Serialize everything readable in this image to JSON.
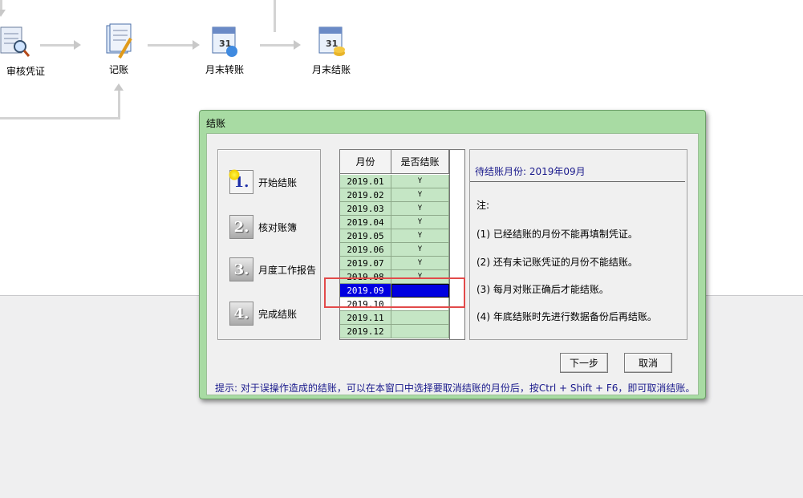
{
  "flow": {
    "nodes": [
      {
        "label": "审核凭证"
      },
      {
        "label": "记账"
      },
      {
        "label": "月末转账"
      },
      {
        "label": "月末结账"
      }
    ]
  },
  "dialog": {
    "title": "结账",
    "steps": [
      {
        "num": "1.",
        "label": "开始结账"
      },
      {
        "num": "2.",
        "label": "核对账簿"
      },
      {
        "num": "3.",
        "label": "月度工作报告"
      },
      {
        "num": "4.",
        "label": "完成结账"
      }
    ],
    "table": {
      "headers": [
        "月份",
        "是否结账"
      ],
      "rows": [
        {
          "month": "2019.01",
          "closed": "Y"
        },
        {
          "month": "2019.02",
          "closed": "Y"
        },
        {
          "month": "2019.03",
          "closed": "Y"
        },
        {
          "month": "2019.04",
          "closed": "Y"
        },
        {
          "month": "2019.05",
          "closed": "Y"
        },
        {
          "month": "2019.06",
          "closed": "Y"
        },
        {
          "month": "2019.07",
          "closed": "Y"
        },
        {
          "month": "2019.08",
          "closed": "Y"
        },
        {
          "month": "2019.09",
          "closed": ""
        },
        {
          "month": "2019.10",
          "closed": ""
        },
        {
          "month": "2019.11",
          "closed": ""
        },
        {
          "month": "2019.12",
          "closed": ""
        }
      ],
      "selected_month": "2019.09"
    },
    "notes": {
      "pending": "待结账月份: 2019年09月",
      "title": "注:",
      "items": [
        "(1) 已经结账的月份不能再填制凭证。",
        "(2) 还有未记账凭证的月份不能结账。",
        "(3) 每月对账正确后才能结账。",
        "(4) 年底结账时先进行数据备份后再结账。"
      ]
    },
    "buttons": {
      "next": "下一步",
      "cancel": "取消"
    },
    "hint": "提示: 对于误操作造成的结账，可以在本窗口中选择要取消结账的月份后，按Ctrl + Shift + F6，即可取消结账。"
  },
  "colors": {
    "dialog_frame": "#a8dba3",
    "row_green": "#c5e6c5",
    "selection": "#0000e0",
    "highlight_box": "#e24a4a",
    "hint_text": "#1a1a8c"
  }
}
